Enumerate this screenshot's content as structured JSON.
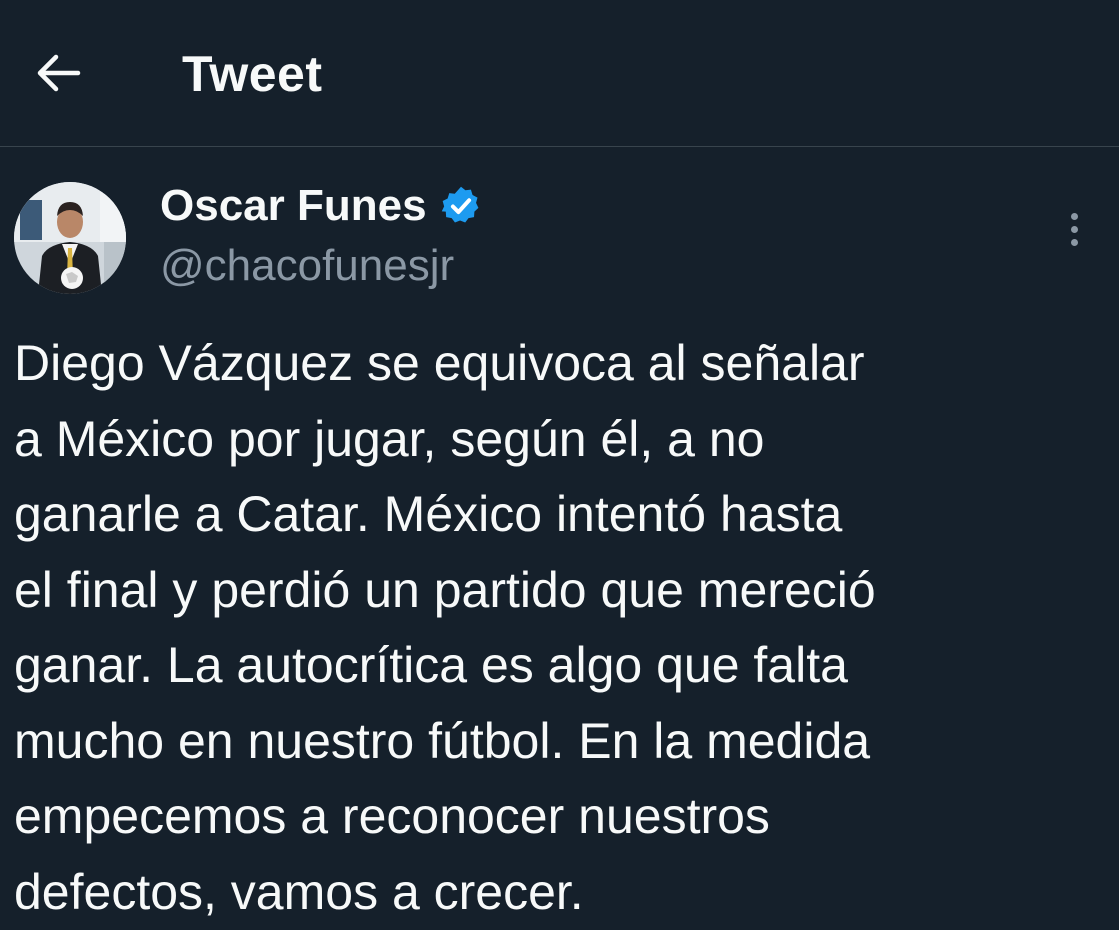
{
  "header": {
    "back_icon": "arrow-left-icon",
    "title": "Tweet"
  },
  "author": {
    "name": "Oscar Funes",
    "handle": "@chacofunesjr",
    "verified_icon": "verified-badge-icon",
    "verified_color": "#1d9bf0",
    "avatar_icon": "avatar-photo"
  },
  "more_icon": "more-vertical-icon",
  "tweet": {
    "lines": [
      "Diego Vázquez se equivoca al señalar",
      "a México por jugar, según él, a no",
      "ganarle a Catar. México intentó hasta",
      "el final y perdió un partido que mereció",
      "ganar. La autocrítica es algo que falta",
      "mucho en nuestro fútbol. En la medida",
      "empecemos a reconocer nuestros",
      "defectos, vamos a crecer."
    ]
  },
  "colors": {
    "background": "#15202b",
    "text": "#f7f9f9",
    "secondary_text": "#8b98a5",
    "divider": "#38444d"
  }
}
